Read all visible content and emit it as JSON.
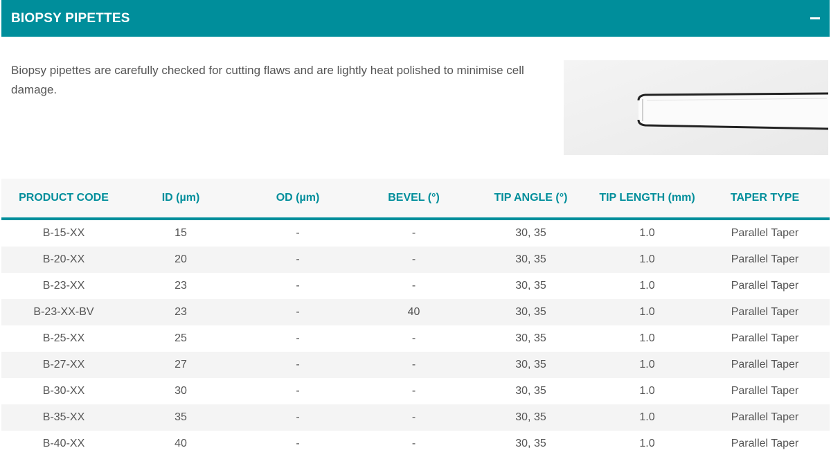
{
  "section": {
    "title": "BIOPSY PIPETTES",
    "collapse_icon": "minus-icon",
    "description": "Biopsy pipettes are carefully checked for cutting flaws and are lightly heat polished to minimise cell damage.",
    "image_label": "biopsy-pipette-image"
  },
  "table": {
    "headers": [
      "PRODUCT CODE",
      "ID (µm)",
      "OD (µm)",
      "BEVEL (°)",
      "TIP ANGLE (°)",
      "TIP LENGTH (mm)",
      "TAPER TYPE"
    ],
    "rows": [
      [
        "B-15-XX",
        "15",
        "-",
        "-",
        "30, 35",
        "1.0",
        "Parallel Taper"
      ],
      [
        "B-20-XX",
        "20",
        "-",
        "-",
        "30, 35",
        "1.0",
        "Parallel Taper"
      ],
      [
        "B-23-XX",
        "23",
        "-",
        "-",
        "30, 35",
        "1.0",
        "Parallel Taper"
      ],
      [
        "B-23-XX-BV",
        "23",
        "-",
        "40",
        "30, 35",
        "1.0",
        "Parallel Taper"
      ],
      [
        "B-25-XX",
        "25",
        "-",
        "-",
        "30, 35",
        "1.0",
        "Parallel Taper"
      ],
      [
        "B-27-XX",
        "27",
        "-",
        "-",
        "30, 35",
        "1.0",
        "Parallel Taper"
      ],
      [
        "B-30-XX",
        "30",
        "-",
        "-",
        "30, 35",
        "1.0",
        "Parallel Taper"
      ],
      [
        "B-35-XX",
        "35",
        "-",
        "-",
        "30, 35",
        "1.0",
        "Parallel Taper"
      ],
      [
        "B-40-XX",
        "40",
        "-",
        "-",
        "30, 35",
        "1.0",
        "Parallel Taper"
      ]
    ]
  },
  "colors": {
    "accent": "#008e9b",
    "text": "#555555",
    "row_alt": "#f4f4f4"
  }
}
